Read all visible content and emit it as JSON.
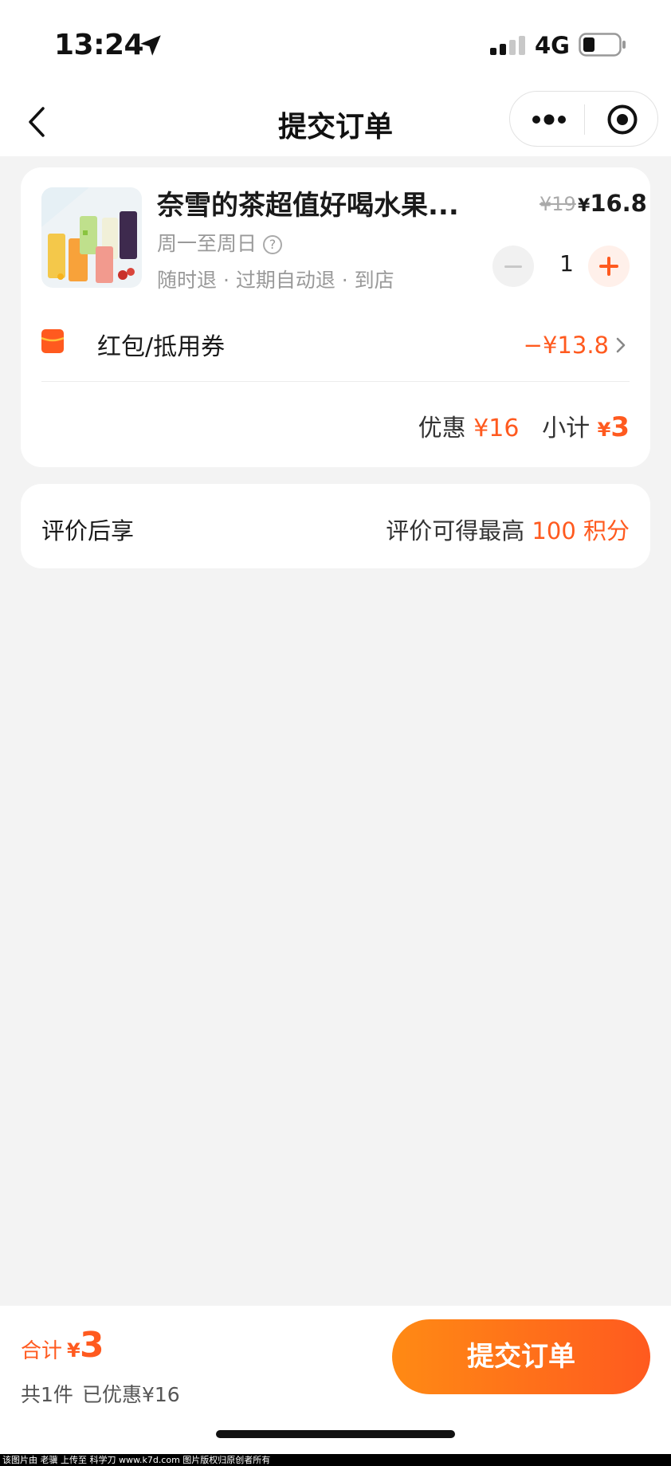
{
  "status_bar": {
    "time": "13:24",
    "network": "4G"
  },
  "nav": {
    "title": "提交订单"
  },
  "product": {
    "title": "奈雪的茶超值好喝水果...",
    "original_price": "¥19",
    "price_symbol": "¥",
    "price": "16.8",
    "schedule": "周一至周日",
    "help_mark": "?",
    "policy": "随时退 · 过期自动退 · 到店",
    "quantity": "1"
  },
  "coupon": {
    "label": "红包/抵用券",
    "value": "−¥13.8"
  },
  "summary": {
    "discount_label": "优惠",
    "discount_value": "¥16",
    "subtotal_label": "小计",
    "subtotal_symbol": "¥",
    "subtotal_value": "3"
  },
  "review": {
    "label": "评价后享",
    "text": "评价可得最高",
    "points": "100 积分"
  },
  "bottom": {
    "total_label": "合计",
    "total_symbol": "¥",
    "total_value": "3",
    "count": "共1件",
    "saved": "已优惠¥16",
    "submit_label": "提交订单"
  },
  "footer": {
    "text": "该图片由 老骥 上传至 科学刀 www.k7d.com 图片版权归原创者所有"
  },
  "colors": {
    "accent": "#ff5a1f",
    "button_gradient_start": "#ff8a14",
    "background": "#f3f3f3"
  }
}
